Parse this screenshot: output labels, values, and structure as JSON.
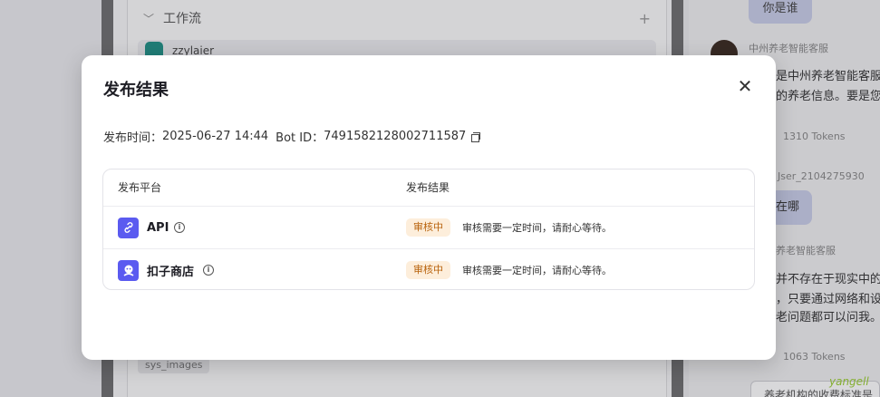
{
  "background": {
    "workflow_section": {
      "label": "工作流",
      "add": "+"
    },
    "workflow_item": "zzylaier",
    "chip": "sys_images",
    "chat": {
      "user_question": "你是谁",
      "bot_name_1": "中州养老智能客服",
      "bot_reply_1": [
        "是中州养老智能客服",
        "的养老信息。要是您"
      ],
      "tokens_1": "1310 Tokens",
      "user_name": "Jser_2104275930",
      "user_question_2": "在哪",
      "bot_name_2": "养老智能客服",
      "bot_reply_2": [
        "并不存在于现实中的",
        "，只要通过网络和设",
        "老问题都可以问我。"
      ],
      "tokens_2": "1063 Tokens",
      "input_text": "养老机构的收费标准是",
      "watermark": "yangell"
    }
  },
  "modal": {
    "title": "发布结果",
    "publish_time_label": "发布时间：",
    "publish_time": "2025-06-27 14:44",
    "bot_id_label": "Bot ID：",
    "bot_id": "7491582128002711587",
    "table": {
      "col_platform": "发布平台",
      "col_result": "发布结果",
      "rows": [
        {
          "platform": "API",
          "status": "审核中",
          "message": "审核需要一定时间，请耐心等待。"
        },
        {
          "platform": "扣子商店",
          "status": "审核中",
          "message": "审核需要一定时间，请耐心等待。"
        }
      ]
    }
  },
  "colors": {
    "accent": "#5b5bf0",
    "status_bg": "#fdeedb",
    "status_fg": "#b8620c"
  },
  "icons": [
    "copy-icon",
    "close-icon",
    "link-icon",
    "store-icon",
    "info-icon",
    "chevron-down-icon",
    "plus-icon"
  ]
}
